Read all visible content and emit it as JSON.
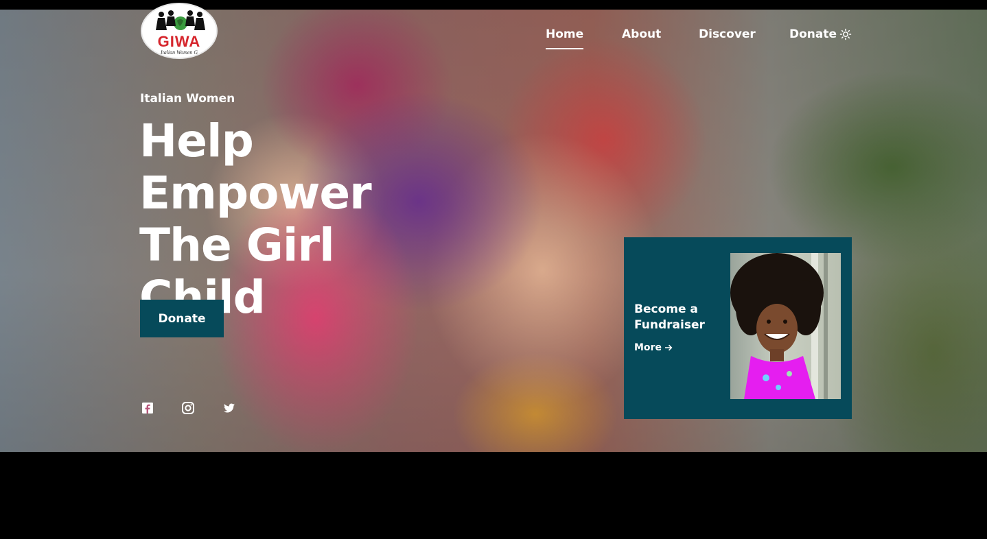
{
  "brand": {
    "logo_text": "GIWA",
    "logo_subtext": "Italian Women G",
    "logo_icon": "globe-figures-icon"
  },
  "nav": {
    "items": [
      {
        "label": "Home",
        "active": true
      },
      {
        "label": "About",
        "active": false
      },
      {
        "label": "Discover",
        "active": false
      },
      {
        "label": "Donate",
        "active": false
      }
    ],
    "theme_icon": "sun-icon"
  },
  "hero": {
    "eyebrow": "Italian Women",
    "headline_line1": "Help Empower",
    "headline_line2_regular": "The ",
    "headline_line2_bold": "Girl",
    "headline_line3": "Child",
    "cta_label": "Donate"
  },
  "social": {
    "icons": [
      "facebook-icon",
      "instagram-icon",
      "twitter-icon"
    ]
  },
  "fundraiser_card": {
    "title": "Become a Fundraiser",
    "more_label": "More",
    "more_icon": "arrow-right-icon"
  },
  "colors": {
    "accent_teal": "#064a5a",
    "logo_red": "#d6262d",
    "text_white": "#ffffff"
  }
}
